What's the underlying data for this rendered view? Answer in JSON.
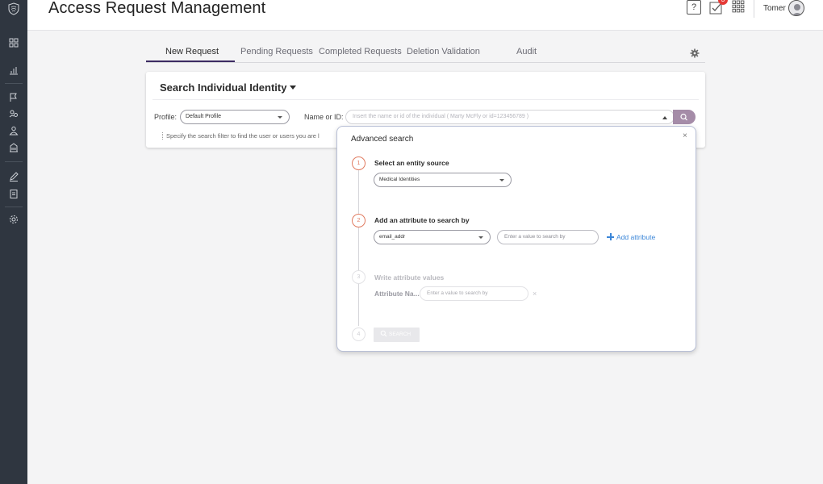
{
  "header": {
    "title": "Access Request Management",
    "help_label": "?",
    "tasks_badge": "3",
    "user_name": "Tomer"
  },
  "tabs": [
    {
      "label": "New Request",
      "active": true
    },
    {
      "label": "Pending Requests",
      "active": false
    },
    {
      "label": "Completed Requests",
      "active": false
    },
    {
      "label": "Deletion Validation",
      "active": false
    },
    {
      "label": "Audit",
      "active": false
    }
  ],
  "search_card": {
    "title": "Search Individual Identity",
    "profile_label": "Profile:",
    "profile_value": "Default Profile",
    "name_label": "Name or ID:",
    "name_placeholder": "Insert the name or id of the individual ( Marty McFly or id=123456789 )",
    "hint": "Specify the search filter to find the user or users you are l"
  },
  "advanced_search": {
    "title": "Advanced search",
    "close_label": "×",
    "steps": [
      {
        "number": "1",
        "title": "Select an entity source",
        "source_value": "Medical Identities"
      },
      {
        "number": "2",
        "title": "Add an attribute to search by",
        "attribute_value": "email_addr",
        "value_placeholder": "Enter a value to search by",
        "add_label": "Add attribute"
      },
      {
        "number": "3",
        "title": "Write attribute values",
        "attribute_name": "Attribute Na...",
        "value_placeholder": "Enter a value to search by",
        "remove_label": "×"
      },
      {
        "number": "4",
        "button_label": "SEARCH"
      }
    ]
  },
  "colors": {
    "sidebar": "#2f3640",
    "accent": "#3d2b63",
    "step_active": "#e07a5f",
    "link": "#3b86d8",
    "search_button": "#a58ca8"
  }
}
